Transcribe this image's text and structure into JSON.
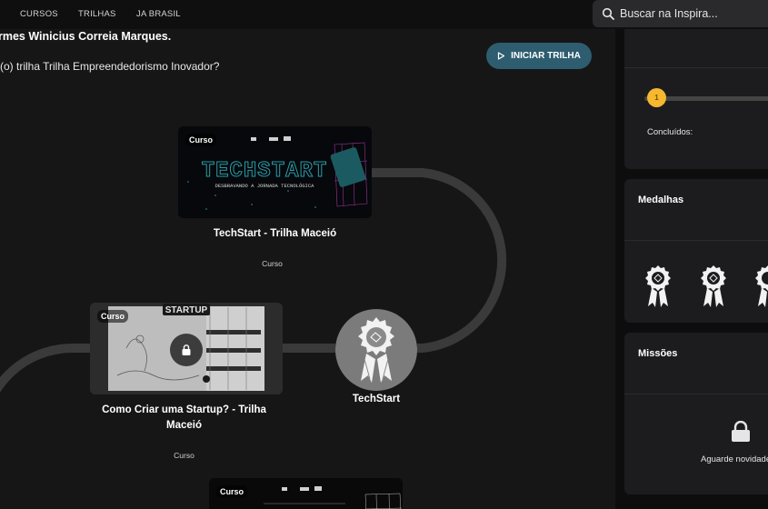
{
  "nav": {
    "items": [
      "CURSOS",
      "TRILHAS",
      "JA BRASIL"
    ],
    "search_placeholder": "Buscar na Inspira..."
  },
  "main": {
    "greeting": "rmes Winicius Correia Marques.",
    "question": "(o) trilha Trilha Empreendedorismo Inovador?",
    "start_button": "INICIAR TRILHA",
    "cards": [
      {
        "tag": "Curso",
        "title": "TechStart - Trilha Maceió",
        "type": "Curso",
        "banner_big": "TECHSTART",
        "banner_small": "DESBRAVANDO A JORNADA TECNOLÓGICA"
      },
      {
        "tag": "Curso",
        "title_line1": "Como Criar uma Startup? - Trilha",
        "title_line2": "Maceió",
        "type": "Curso",
        "banner_big": "STARTUP",
        "locked": true
      },
      {
        "tag": "Curso"
      }
    ],
    "medal_node": {
      "label": "TechStart"
    }
  },
  "sidebar": {
    "progress_value": "1",
    "completed_label": "Concluídos:",
    "medals_title": "Medalhas",
    "missions_title": "Missões",
    "missions_waiting": "Aguarde novidades"
  },
  "colors": {
    "accent": "#2d5d6f",
    "progress": "#f5b82e",
    "path": "#3a3a3b"
  }
}
